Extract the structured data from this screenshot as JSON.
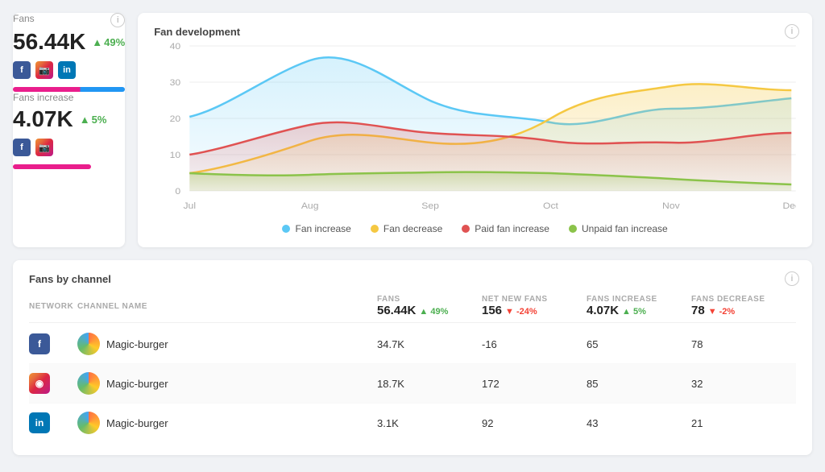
{
  "fans_card": {
    "title": "Fans",
    "section_label": "Fans",
    "value": "56.44K",
    "trend_pct": "49%",
    "trend_dir": "up"
  },
  "fans_increase_card": {
    "section_label": "Fans increase",
    "value": "4.07K",
    "trend_pct": "5%",
    "trend_dir": "up"
  },
  "fan_dev_card": {
    "title": "Fan development"
  },
  "legend": [
    {
      "label": "Fan increase",
      "color": "#5bc8f5"
    },
    {
      "label": "Fan decrease",
      "color": "#f5c842"
    },
    {
      "label": "Paid fan increase",
      "color": "#e05252"
    },
    {
      "label": "Unpaid fan increase",
      "color": "#8bc34a"
    }
  ],
  "chart_y_labels": [
    "0",
    "10",
    "20",
    "30",
    "40"
  ],
  "chart_x_labels": [
    "Jul",
    "Aug",
    "Sep",
    "Oct",
    "Nov",
    "Dec"
  ],
  "fans_by_channel": {
    "title": "Fans by channel",
    "headers": {
      "network": "Network",
      "channel": "Channel Name",
      "fans": "Fans",
      "fans_value": "56.44K",
      "fans_trend": "49%",
      "fans_trend_dir": "up",
      "net_new": "Net New Fans",
      "net_new_value": "156",
      "net_new_trend": "-24%",
      "net_new_trend_dir": "down",
      "fans_increase": "Fans Increase",
      "fans_increase_value": "4.07K",
      "fans_increase_trend": "5%",
      "fans_increase_trend_dir": "up",
      "fans_decrease": "Fans Decrease",
      "fans_decrease_value": "78",
      "fans_decrease_trend": "-2%",
      "fans_decrease_trend_dir": "down"
    },
    "rows": [
      {
        "network": "fb",
        "channel": "Magic-burger",
        "fans": "34.7K",
        "net_new": "-16",
        "fans_increase": "65",
        "fans_decrease": "78"
      },
      {
        "network": "ig",
        "channel": "Magic-burger",
        "fans": "18.7K",
        "net_new": "172",
        "fans_increase": "85",
        "fans_decrease": "32"
      },
      {
        "network": "li",
        "channel": "Magic-burger",
        "fans": "3.1K",
        "net_new": "92",
        "fans_increase": "43",
        "fans_decrease": "21"
      }
    ]
  },
  "info_icon_label": "i"
}
